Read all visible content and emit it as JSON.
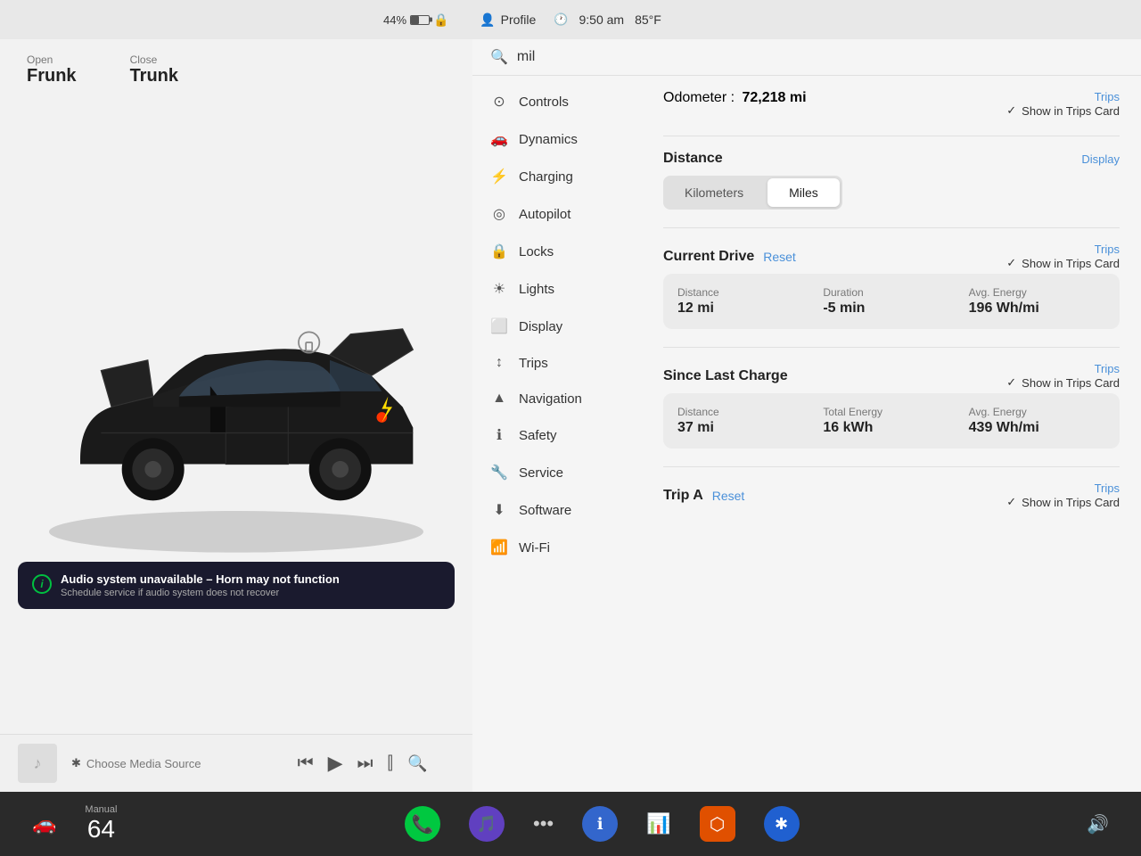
{
  "statusBar": {
    "battery_percent": "44%",
    "profile_label": "Profile",
    "time": "9:50 am",
    "temperature": "85°F"
  },
  "leftPanel": {
    "frunk_open_label": "Open",
    "frunk_label": "Frunk",
    "trunk_close_label": "Close",
    "trunk_label": "Trunk",
    "warning_title": "Audio system unavailable – Horn may not function",
    "warning_subtitle": "Schedule service if audio system does not recover",
    "media_source_label": "Choose Media Source"
  },
  "navMenu": {
    "items": [
      {
        "id": "controls",
        "icon": "⊙",
        "label": "Controls"
      },
      {
        "id": "dynamics",
        "icon": "🚗",
        "label": "Dynamics"
      },
      {
        "id": "charging",
        "icon": "⚡",
        "label": "Charging"
      },
      {
        "id": "autopilot",
        "icon": "◎",
        "label": "Autopilot"
      },
      {
        "id": "locks",
        "icon": "🔒",
        "label": "Locks"
      },
      {
        "id": "lights",
        "icon": "☀",
        "label": "Lights"
      },
      {
        "id": "display",
        "icon": "⬜",
        "label": "Display"
      },
      {
        "id": "trips",
        "icon": "↕",
        "label": "Trips"
      },
      {
        "id": "navigation",
        "icon": "▲",
        "label": "Navigation"
      },
      {
        "id": "safety",
        "icon": "ℹ",
        "label": "Safety"
      },
      {
        "id": "service",
        "icon": "🔧",
        "label": "Service"
      },
      {
        "id": "software",
        "icon": "⬇",
        "label": "Software"
      },
      {
        "id": "wifi",
        "icon": "📶",
        "label": "Wi-Fi"
      }
    ]
  },
  "search": {
    "query": "mil",
    "placeholder": "Search"
  },
  "contentArea": {
    "odometer_label": "Odometer :",
    "odometer_value": "72,218 mi",
    "trips_label": "Trips",
    "show_trips_card_label": "Show in Trips Card",
    "distance_label": "Distance",
    "display_link": "Display",
    "distance_options": [
      "Kilometers",
      "Miles"
    ],
    "distance_active": "Miles",
    "current_drive_title": "Current Drive",
    "current_drive_reset": "Reset",
    "current_drive_trips": "Trips",
    "current_drive_show_trips": "Show in Trips Card",
    "drive_distance_label": "Distance",
    "drive_distance_value": "12 mi",
    "drive_duration_label": "Duration",
    "drive_duration_value": "-5 min",
    "drive_energy_label": "Avg. Energy",
    "drive_energy_value": "196 Wh/mi",
    "since_charge_title": "Since Last Charge",
    "since_charge_trips": "Trips",
    "since_charge_show": "Show in Trips Card",
    "charge_distance_label": "Distance",
    "charge_distance_value": "37 mi",
    "charge_energy_label": "Total Energy",
    "charge_energy_value": "16 kWh",
    "charge_avg_energy_label": "Avg. Energy",
    "charge_avg_energy_value": "439 Wh/mi",
    "trip_a_label": "Trip A",
    "trip_a_reset": "Reset",
    "trip_a_trips": "Trips",
    "trip_a_show_trips": "Show in Trips Card"
  },
  "taskbar": {
    "manual_label": "Manual",
    "temp_value": "64",
    "more_label": "...",
    "volume_icon": "🔊"
  }
}
